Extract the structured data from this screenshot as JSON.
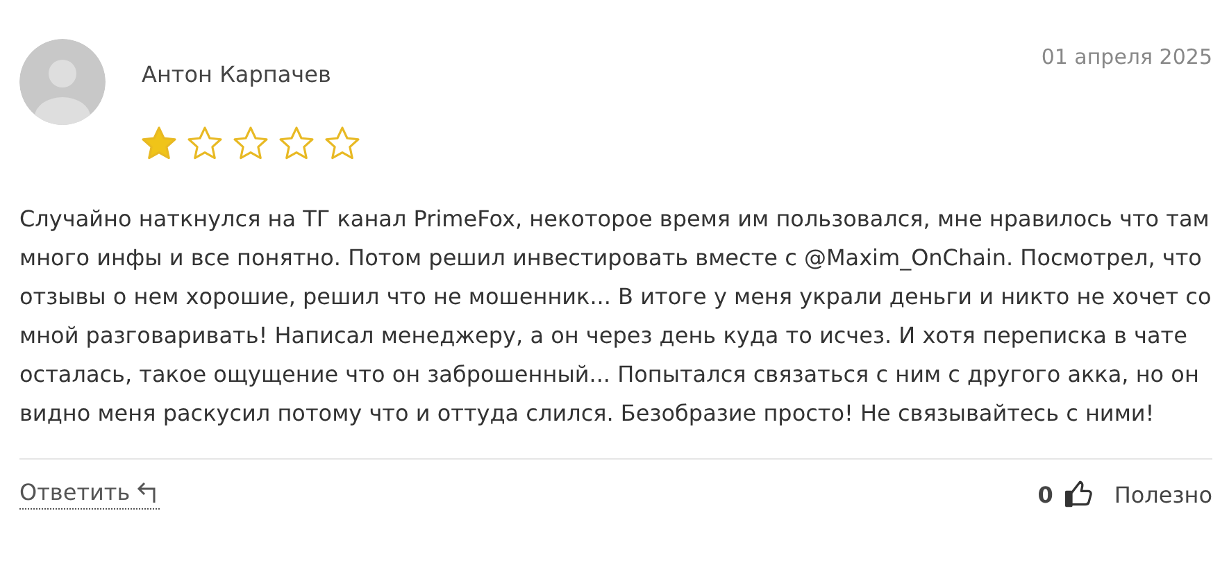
{
  "review": {
    "author": "Антон Карпачев",
    "date": "01 апреля 2025",
    "stars": 1,
    "text": "Случайно наткнулся на ТГ канал PrimeFox, некоторое время им пользовался, мне нравилось что там много инфы и все понятно. Потом решил инвестировать вместе с @Maxim_OnChain. Посмотрел, что отзывы о нем хорошие, решил что не мошенник... В итоге у меня украли деньги и никто не хочет со мной разговаривать! Написал менеджеру, а он через день куда то исчез. И хотя переписка в чате осталась, такое ощущение что он заброшенный... Попытался связаться с ним с другого акка, но он видно меня раскусил потому что и оттуда слился. Безобразие просто! Не связывайтесь с ними!",
    "reply": "Ответить",
    "helpful_count": "0",
    "helpful": "Полезно"
  }
}
